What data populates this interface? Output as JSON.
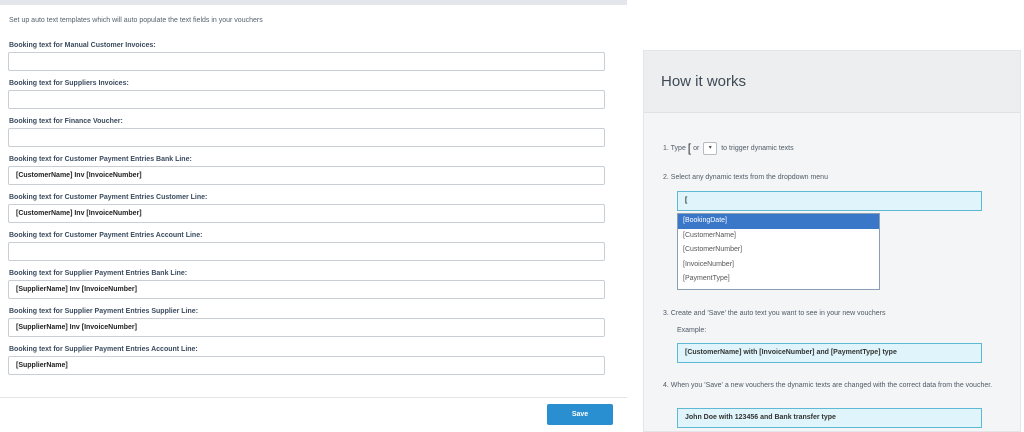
{
  "intro": "Set up auto text templates which will auto populate the text fields in your vouchers",
  "fields": [
    {
      "label": "Booking text for Manual Customer Invoices:",
      "value": ""
    },
    {
      "label": "Booking text for Suppliers Invoices:",
      "value": ""
    },
    {
      "label": "Booking text for Finance Voucher:",
      "value": ""
    },
    {
      "label": "Booking text for Customer Payment Entries Bank Line:",
      "value": "[CustomerName] Inv [InvoiceNumber]"
    },
    {
      "label": "Booking text for Customer Payment Entries Customer Line:",
      "value": "[CustomerName] Inv [InvoiceNumber]"
    },
    {
      "label": "Booking text for Customer Payment Entries Account Line:",
      "value": ""
    },
    {
      "label": "Booking text for Supplier Payment Entries Bank Line:",
      "value": "[SupplierName] Inv [InvoiceNumber]"
    },
    {
      "label": "Booking text for Supplier Payment Entries Supplier Line:",
      "value": "[SupplierName] Inv [InvoiceNumber]"
    },
    {
      "label": "Booking text for Supplier Payment Entries Account Line:",
      "value": "[SupplierName]"
    }
  ],
  "save_label": "Save",
  "help": {
    "title": "How it works",
    "step1": {
      "prefix": "1. Type",
      "bracket": "[",
      "or": "or",
      "key": "▾",
      "suffix": "to trigger dynamic texts"
    },
    "step2": "2. Select any dynamic texts from the dropdown menu",
    "demo_input": "[",
    "dropdown": [
      "[BookingDate]",
      "[CustomerName]",
      "[CustomerNumber]",
      "[InvoiceNumber]",
      "[PaymentType]"
    ],
    "dropdown_selected": "[BookingDate]",
    "step3": "3. Create and 'Save' the auto text you want to see in your new vouchers",
    "example_label": "Example:",
    "example_template": "[CustomerName] with [InvoiceNumber] and [PaymentType] type",
    "step4": "4. When you 'Save' a new vouchers the dynamic texts are changed with the correct data from the voucher.",
    "example_result": "John Doe with 123456 and Bank transfer type"
  }
}
